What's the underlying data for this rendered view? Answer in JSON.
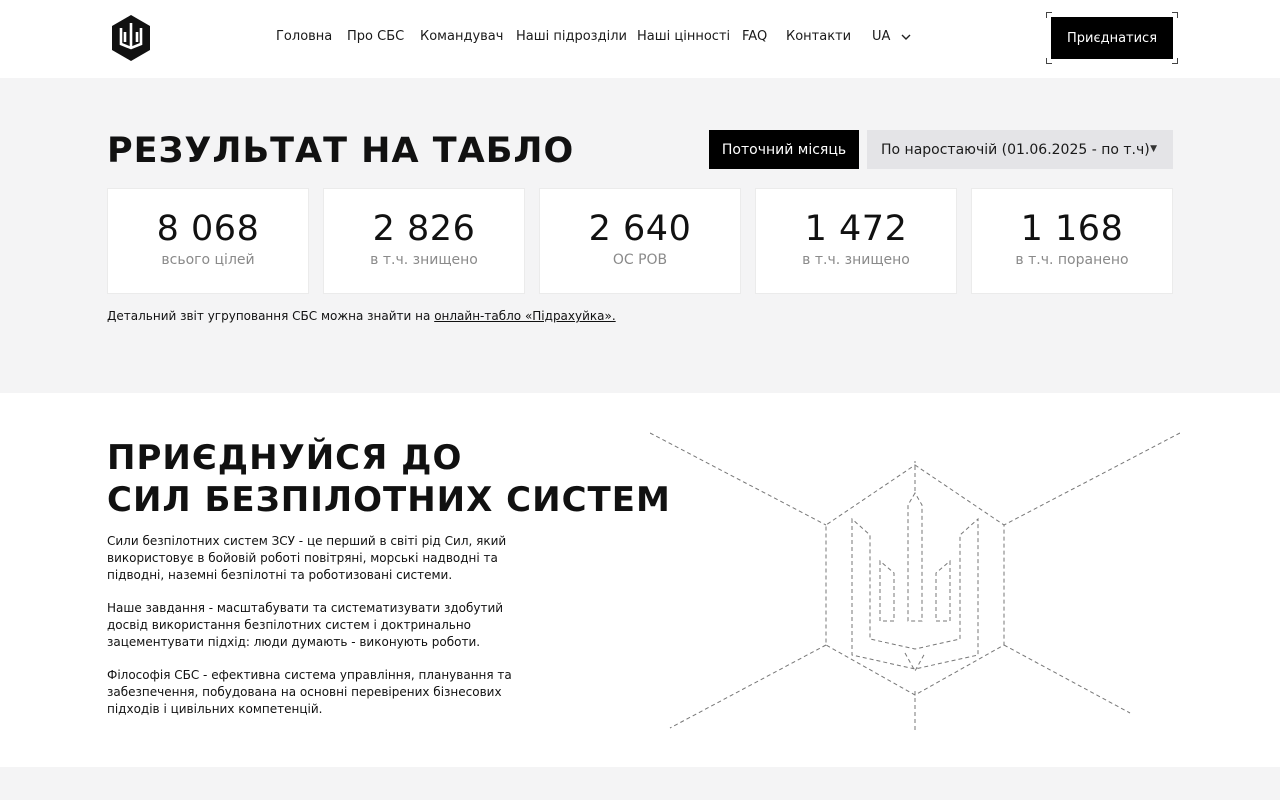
{
  "nav": {
    "items": [
      "Головна",
      "Про СБС",
      "Командувач",
      "Наші підрозділи",
      "Наші цінності",
      "FAQ",
      "Контакти"
    ],
    "lang": "UA",
    "join_label": "Приєднатися"
  },
  "score": {
    "title": "РЕЗУЛЬТАТ НА ТАБЛО",
    "tab_active": "Поточний місяць",
    "tab_select": "По наростаючій (01.06.2025 - по т.ч)",
    "cards": [
      {
        "value": "8 068",
        "label": "всього цілей"
      },
      {
        "value": "2 826",
        "label": "в т.ч. знищено"
      },
      {
        "value": "2 640",
        "label": "ОС РОВ"
      },
      {
        "value": "1 472",
        "label": "в т.ч. знищено"
      },
      {
        "value": "1 168",
        "label": "в т.ч. поранено"
      }
    ],
    "note_prefix": "Детальний звіт угруповання СБС можна знайти на ",
    "note_link": "онлайн-табло «Підрахуйка»."
  },
  "join": {
    "title_line1": "ПРИЄДНУЙСЯ ДО",
    "title_line2": "СИЛ БЕЗПІЛОТНИХ СИСТЕМ",
    "p1": "Сили безпілотних систем ЗСУ - це перший в світі рід Сил, який використовує в бойовій роботі повітряні, морські надводні та підводні, наземні безпілотні та роботизовані системи.",
    "p2": "Наше завдання - масштабувати та систематизувати здобутий досвід використання безпілотних систем і доктринально зацементувати підхід: люди думають - виконують роботи.",
    "p3": "Філософія СБС - ефективна система управління, планування та забезпечення, побудована на основні перевірених бізнесових підходів і цивільних компетенцій."
  },
  "icons": {
    "logo": "trident-hexagon-logo",
    "lang_chevron": "chevron-down-icon",
    "select_caret": "caret-down-icon",
    "art": "dashed-trident-hexagon-illustration"
  },
  "colors": {
    "accent": "#000000",
    "section_bg": "#f4f4f5",
    "muted_text": "#8a8a8a"
  }
}
